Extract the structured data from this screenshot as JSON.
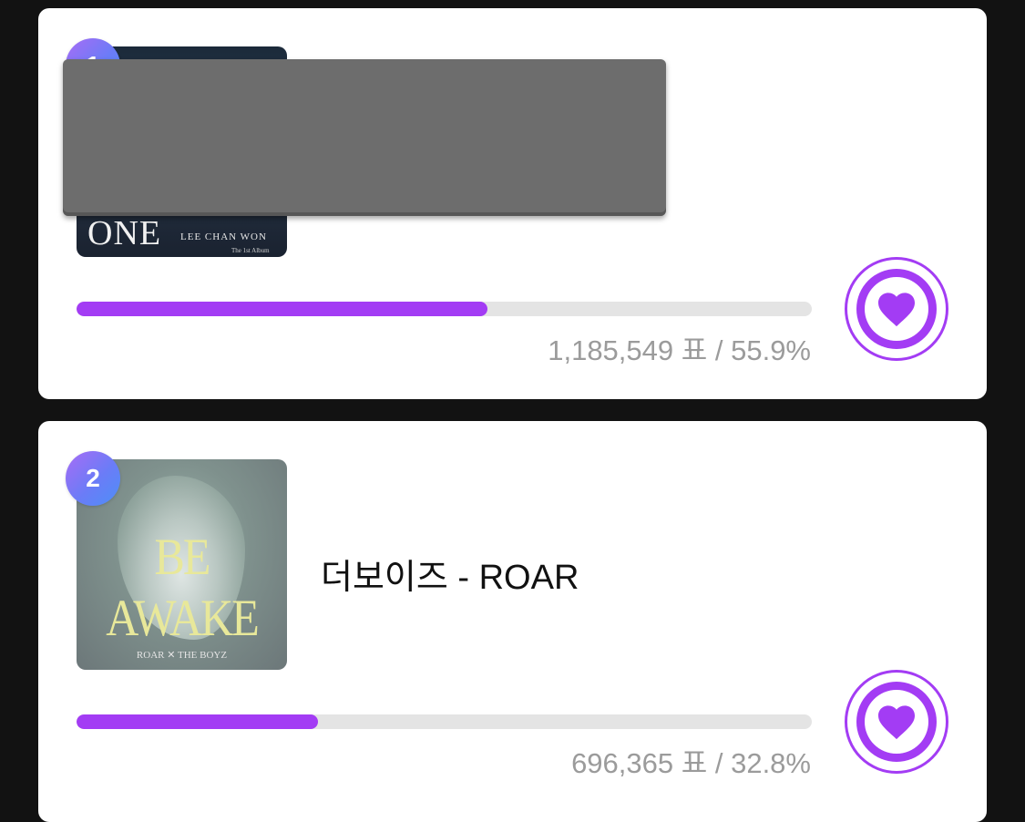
{
  "colors": {
    "accent": "#a33cf4",
    "track": "#e4e4e4",
    "background": "#121212"
  },
  "entries": [
    {
      "rank": "1",
      "title": "",
      "album_art": {
        "title": "ONE",
        "artist": "LEE CHAN WON",
        "sub": "The 1st Album"
      },
      "votes_text": "1,185,549 표 / 55.9%",
      "percent": 55.9,
      "icon": "heart-icon"
    },
    {
      "rank": "2",
      "title": "더보이즈 - ROAR",
      "album_art": {
        "title": "BE AWAKE",
        "footer": "ROAR ✕ THE BOYZ"
      },
      "votes_text": "696,365 표 / 32.8%",
      "percent": 32.8,
      "icon": "heart-icon"
    }
  ]
}
